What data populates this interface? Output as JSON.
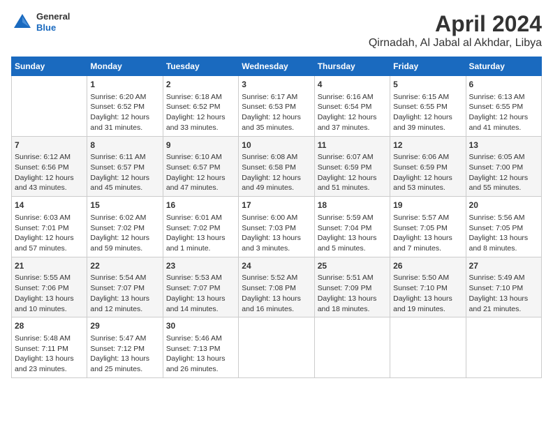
{
  "header": {
    "logo": {
      "general": "General",
      "blue": "Blue"
    },
    "title": "April 2024",
    "subtitle": "Qirnadah, Al Jabal al Akhdar, Libya"
  },
  "calendar": {
    "days_of_week": [
      "Sunday",
      "Monday",
      "Tuesday",
      "Wednesday",
      "Thursday",
      "Friday",
      "Saturday"
    ],
    "weeks": [
      [
        {
          "day": "",
          "content": ""
        },
        {
          "day": "1",
          "content": "Sunrise: 6:20 AM\nSunset: 6:52 PM\nDaylight: 12 hours\nand 31 minutes."
        },
        {
          "day": "2",
          "content": "Sunrise: 6:18 AM\nSunset: 6:52 PM\nDaylight: 12 hours\nand 33 minutes."
        },
        {
          "day": "3",
          "content": "Sunrise: 6:17 AM\nSunset: 6:53 PM\nDaylight: 12 hours\nand 35 minutes."
        },
        {
          "day": "4",
          "content": "Sunrise: 6:16 AM\nSunset: 6:54 PM\nDaylight: 12 hours\nand 37 minutes."
        },
        {
          "day": "5",
          "content": "Sunrise: 6:15 AM\nSunset: 6:55 PM\nDaylight: 12 hours\nand 39 minutes."
        },
        {
          "day": "6",
          "content": "Sunrise: 6:13 AM\nSunset: 6:55 PM\nDaylight: 12 hours\nand 41 minutes."
        }
      ],
      [
        {
          "day": "7",
          "content": "Sunrise: 6:12 AM\nSunset: 6:56 PM\nDaylight: 12 hours\nand 43 minutes."
        },
        {
          "day": "8",
          "content": "Sunrise: 6:11 AM\nSunset: 6:57 PM\nDaylight: 12 hours\nand 45 minutes."
        },
        {
          "day": "9",
          "content": "Sunrise: 6:10 AM\nSunset: 6:57 PM\nDaylight: 12 hours\nand 47 minutes."
        },
        {
          "day": "10",
          "content": "Sunrise: 6:08 AM\nSunset: 6:58 PM\nDaylight: 12 hours\nand 49 minutes."
        },
        {
          "day": "11",
          "content": "Sunrise: 6:07 AM\nSunset: 6:59 PM\nDaylight: 12 hours\nand 51 minutes."
        },
        {
          "day": "12",
          "content": "Sunrise: 6:06 AM\nSunset: 6:59 PM\nDaylight: 12 hours\nand 53 minutes."
        },
        {
          "day": "13",
          "content": "Sunrise: 6:05 AM\nSunset: 7:00 PM\nDaylight: 12 hours\nand 55 minutes."
        }
      ],
      [
        {
          "day": "14",
          "content": "Sunrise: 6:03 AM\nSunset: 7:01 PM\nDaylight: 12 hours\nand 57 minutes."
        },
        {
          "day": "15",
          "content": "Sunrise: 6:02 AM\nSunset: 7:02 PM\nDaylight: 12 hours\nand 59 minutes."
        },
        {
          "day": "16",
          "content": "Sunrise: 6:01 AM\nSunset: 7:02 PM\nDaylight: 13 hours\nand 1 minute."
        },
        {
          "day": "17",
          "content": "Sunrise: 6:00 AM\nSunset: 7:03 PM\nDaylight: 13 hours\nand 3 minutes."
        },
        {
          "day": "18",
          "content": "Sunrise: 5:59 AM\nSunset: 7:04 PM\nDaylight: 13 hours\nand 5 minutes."
        },
        {
          "day": "19",
          "content": "Sunrise: 5:57 AM\nSunset: 7:05 PM\nDaylight: 13 hours\nand 7 minutes."
        },
        {
          "day": "20",
          "content": "Sunrise: 5:56 AM\nSunset: 7:05 PM\nDaylight: 13 hours\nand 8 minutes."
        }
      ],
      [
        {
          "day": "21",
          "content": "Sunrise: 5:55 AM\nSunset: 7:06 PM\nDaylight: 13 hours\nand 10 minutes."
        },
        {
          "day": "22",
          "content": "Sunrise: 5:54 AM\nSunset: 7:07 PM\nDaylight: 13 hours\nand 12 minutes."
        },
        {
          "day": "23",
          "content": "Sunrise: 5:53 AM\nSunset: 7:07 PM\nDaylight: 13 hours\nand 14 minutes."
        },
        {
          "day": "24",
          "content": "Sunrise: 5:52 AM\nSunset: 7:08 PM\nDaylight: 13 hours\nand 16 minutes."
        },
        {
          "day": "25",
          "content": "Sunrise: 5:51 AM\nSunset: 7:09 PM\nDaylight: 13 hours\nand 18 minutes."
        },
        {
          "day": "26",
          "content": "Sunrise: 5:50 AM\nSunset: 7:10 PM\nDaylight: 13 hours\nand 19 minutes."
        },
        {
          "day": "27",
          "content": "Sunrise: 5:49 AM\nSunset: 7:10 PM\nDaylight: 13 hours\nand 21 minutes."
        }
      ],
      [
        {
          "day": "28",
          "content": "Sunrise: 5:48 AM\nSunset: 7:11 PM\nDaylight: 13 hours\nand 23 minutes."
        },
        {
          "day": "29",
          "content": "Sunrise: 5:47 AM\nSunset: 7:12 PM\nDaylight: 13 hours\nand 25 minutes."
        },
        {
          "day": "30",
          "content": "Sunrise: 5:46 AM\nSunset: 7:13 PM\nDaylight: 13 hours\nand 26 minutes."
        },
        {
          "day": "",
          "content": ""
        },
        {
          "day": "",
          "content": ""
        },
        {
          "day": "",
          "content": ""
        },
        {
          "day": "",
          "content": ""
        }
      ]
    ]
  }
}
